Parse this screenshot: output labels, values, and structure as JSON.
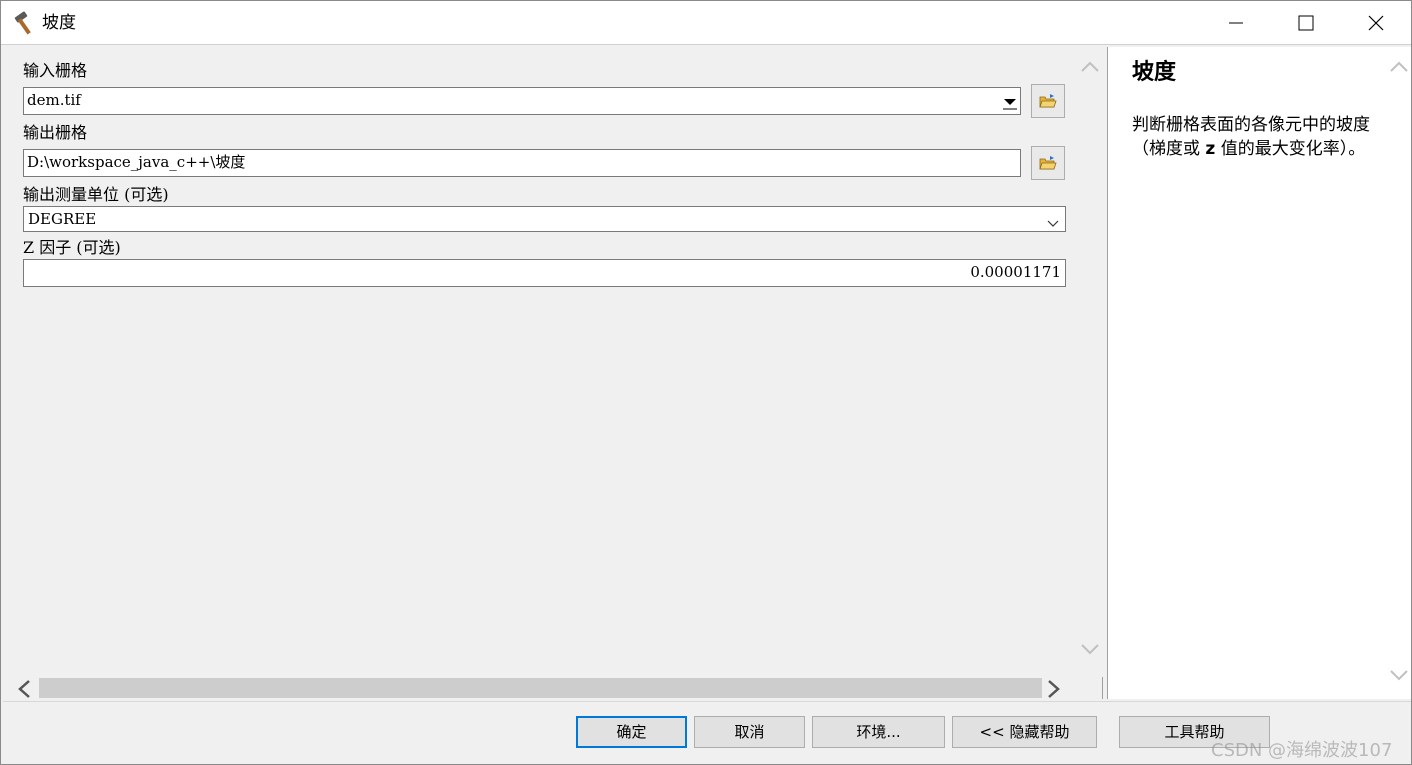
{
  "window": {
    "title": "坡度",
    "icon": "hammer-icon"
  },
  "form": {
    "input_raster": {
      "label": "输入栅格",
      "value": "dem.tif"
    },
    "output_raster": {
      "label": "输出栅格",
      "value": "D:\\workspace_java_c++\\坡度"
    },
    "measurement": {
      "label": "输出测量单位 (可选)",
      "value": "DEGREE"
    },
    "z_factor": {
      "label": "Z 因子 (可选)",
      "value": "0.00001171"
    }
  },
  "help": {
    "title": "坡度",
    "body_before": "判断栅格表面的各像元中的坡度（梯度或 ",
    "body_bold": "z",
    "body_after": " 值的最大变化率）。"
  },
  "buttons": {
    "ok": "确定",
    "cancel": "取消",
    "environments": "环境...",
    "hide_help": "<< 隐藏帮助",
    "tool_help": "工具帮助"
  },
  "watermark": "CSDN @海绵波波107",
  "colors": {
    "accent": "#0078d7",
    "folder": "#e8b13a"
  }
}
